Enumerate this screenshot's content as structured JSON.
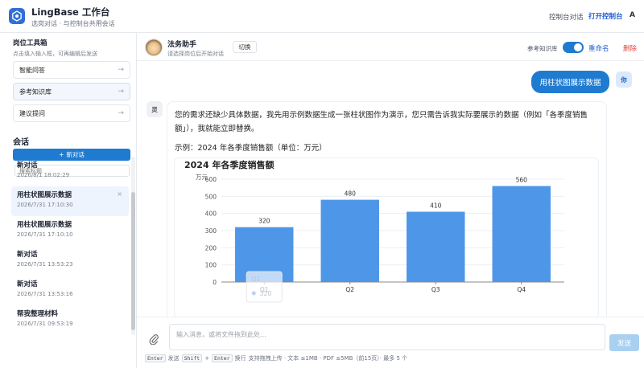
{
  "app": {
    "title": "LingBase 工作台",
    "subtitle": "选岗对话 · 与控制台共用会话",
    "link_console_chat": "控制台对话",
    "link_open_console": "打开控制台",
    "avatar": "A"
  },
  "toolbox": {
    "title": "岗位工具箱",
    "subtitle": "点击填入输入框，可再编辑后发送",
    "items": [
      {
        "label": "智能问答"
      },
      {
        "label": "参考知识库"
      },
      {
        "label": "建议提问"
      }
    ]
  },
  "sessions": {
    "title": "会话",
    "new_label": "新对话",
    "search_placeholder": "搜索标题",
    "items": [
      {
        "name": "新对话",
        "date": "2026/8/1 18:02:29"
      },
      {
        "name": "用柱状图展示数据",
        "date": "2026/7/31 17:10:30"
      },
      {
        "name": "用柱状图展示数据",
        "date": "2026/7/31 17:10:10"
      },
      {
        "name": "新对话",
        "date": "2026/7/31 13:53:23"
      },
      {
        "name": "新对话",
        "date": "2026/7/31 13:53:16"
      },
      {
        "name": "帮我整理材料",
        "date": "2026/7/31 09:53:19"
      }
    ]
  },
  "chat": {
    "bot_name": "法务助手",
    "bot_sub": "请选择岗位后开始对话",
    "switch_label": "切换",
    "kb_label": "参考知识库",
    "kb_enabled": true,
    "rename_label": "重命名",
    "delete_label": "删除",
    "user_avatar": "你",
    "ai_avatar": "灵",
    "user_message": "用柱状图展示数据",
    "ai_text": "您的需求还缺少具体数据，我先用示例数据生成一张柱状图作为演示，您只需告诉我实际要展示的数据（例如「各季度销售额」），我就能立即替换。",
    "ai_example": "示例：2024 年各季度销售额（单位：万元）"
  },
  "chart_data": {
    "type": "bar",
    "title": "2024 年各季度销售额",
    "ylabel": "万元",
    "xlabel": "",
    "categories": [
      "Q1",
      "Q2",
      "Q3",
      "Q4"
    ],
    "values": [
      320,
      480,
      410,
      560
    ],
    "ylim": [
      0,
      600
    ],
    "yticks": [
      0,
      100,
      200,
      300,
      400,
      500,
      600
    ],
    "grid": true,
    "color": "#4e96e8",
    "tooltip": {
      "category": "Q1",
      "value": "320"
    }
  },
  "composer": {
    "placeholder": "输入消息，或将文件拖到此处…",
    "send_label": "发送",
    "hint_enter": "Enter",
    "hint_send": "发送",
    "hint_shift": "Shift",
    "hint_plus": "+",
    "hint_newline": "换行",
    "hint_rest": "支持拖拽上传 · 文本 ≤1MB · PDF ≤5MB（前15页）· 最多 5 个"
  }
}
